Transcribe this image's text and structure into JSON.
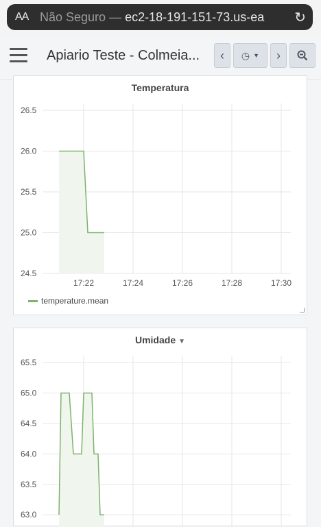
{
  "browser": {
    "aa_label": "AA",
    "insecure_label": "Não Seguro —",
    "url_host": "ec2-18-191-151-73.us-ea"
  },
  "header": {
    "title": "Apiario Teste - Colmeia..."
  },
  "panels": [
    {
      "title": "Temperatura",
      "legend": "temperature.mean"
    },
    {
      "title": "Umidade"
    }
  ],
  "colors": {
    "series": "#7eb26d",
    "fill": "#f0f6ee"
  },
  "icons": {
    "reload": "reload-icon",
    "menu": "hamburger-icon",
    "prev": "chevron-left-icon",
    "time": "clock-icon",
    "next": "chevron-right-icon",
    "zoom": "zoom-out-icon"
  },
  "chart_data": [
    {
      "type": "area",
      "title": "Temperatura",
      "x_ticks": [
        "17:22",
        "17:24",
        "17:26",
        "17:28",
        "17:30"
      ],
      "y_ticks": [
        "26.5",
        "26.0",
        "25.5",
        "25.0",
        "24.5"
      ],
      "ylim": [
        24.5,
        26.5
      ],
      "series": [
        {
          "name": "temperature.mean",
          "points": [
            [
              "17:21:00",
              26.0
            ],
            [
              "17:22:00",
              26.0
            ],
            [
              "17:22:10",
              25.0
            ],
            [
              "17:22:50",
              25.0
            ]
          ]
        }
      ]
    },
    {
      "type": "area",
      "title": "Umidade",
      "x_ticks": [],
      "y_ticks": [
        "65.5",
        "65.0",
        "64.5",
        "64.0",
        "63.5",
        "63.0"
      ],
      "ylim": [
        62.8,
        65.5
      ],
      "series": [
        {
          "points": [
            [
              "17:21:00",
              63.0
            ],
            [
              "17:21:05",
              65.0
            ],
            [
              "17:21:25",
              65.0
            ],
            [
              "17:21:35",
              64.0
            ],
            [
              "17:21:55",
              64.0
            ],
            [
              "17:22:00",
              65.0
            ],
            [
              "17:22:20",
              65.0
            ],
            [
              "17:22:25",
              64.0
            ],
            [
              "17:22:35",
              64.0
            ],
            [
              "17:22:40",
              63.0
            ],
            [
              "17:22:50",
              63.0
            ]
          ]
        }
      ]
    }
  ]
}
